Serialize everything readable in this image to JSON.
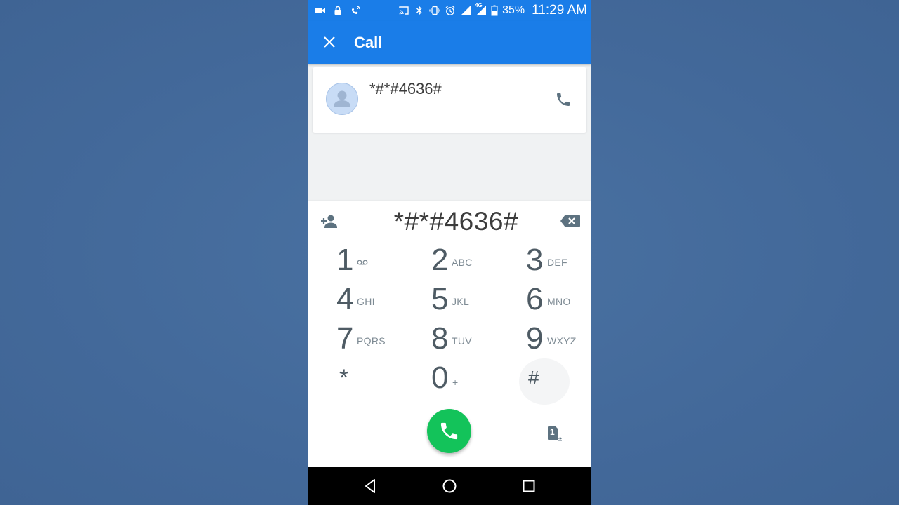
{
  "status_bar": {
    "battery_percent": "35%",
    "time": "11:29 AM",
    "network": "4G",
    "icons": [
      "video-icon",
      "lock-icon",
      "wifi-calling-icon",
      "cast-icon",
      "bluetooth-icon",
      "vibrate-icon",
      "alarm-icon",
      "signal-icon",
      "battery-icon"
    ]
  },
  "app_bar": {
    "title": "Call",
    "close_icon": "close-icon"
  },
  "suggestion": {
    "number": "*#*#4636#",
    "avatar_icon": "person-icon",
    "call_icon": "phone-icon"
  },
  "dialpad": {
    "entered_digits": "*#*#4636#",
    "keys": [
      {
        "digit": "1",
        "letters": "",
        "icon": "voicemail-icon"
      },
      {
        "digit": "2",
        "letters": "ABC"
      },
      {
        "digit": "3",
        "letters": "DEF"
      },
      {
        "digit": "4",
        "letters": "GHI"
      },
      {
        "digit": "5",
        "letters": "JKL"
      },
      {
        "digit": "6",
        "letters": "MNO"
      },
      {
        "digit": "7",
        "letters": "PQRS"
      },
      {
        "digit": "8",
        "letters": "TUV"
      },
      {
        "digit": "9",
        "letters": "WXYZ"
      },
      {
        "digit": "*",
        "letters": ""
      },
      {
        "digit": "0",
        "letters": "+"
      },
      {
        "digit": "#",
        "letters": ""
      }
    ],
    "sim_label": "1"
  },
  "colors": {
    "accent": "#1a7de8",
    "call_green": "#13c35a",
    "key_text": "#4e5b64"
  }
}
